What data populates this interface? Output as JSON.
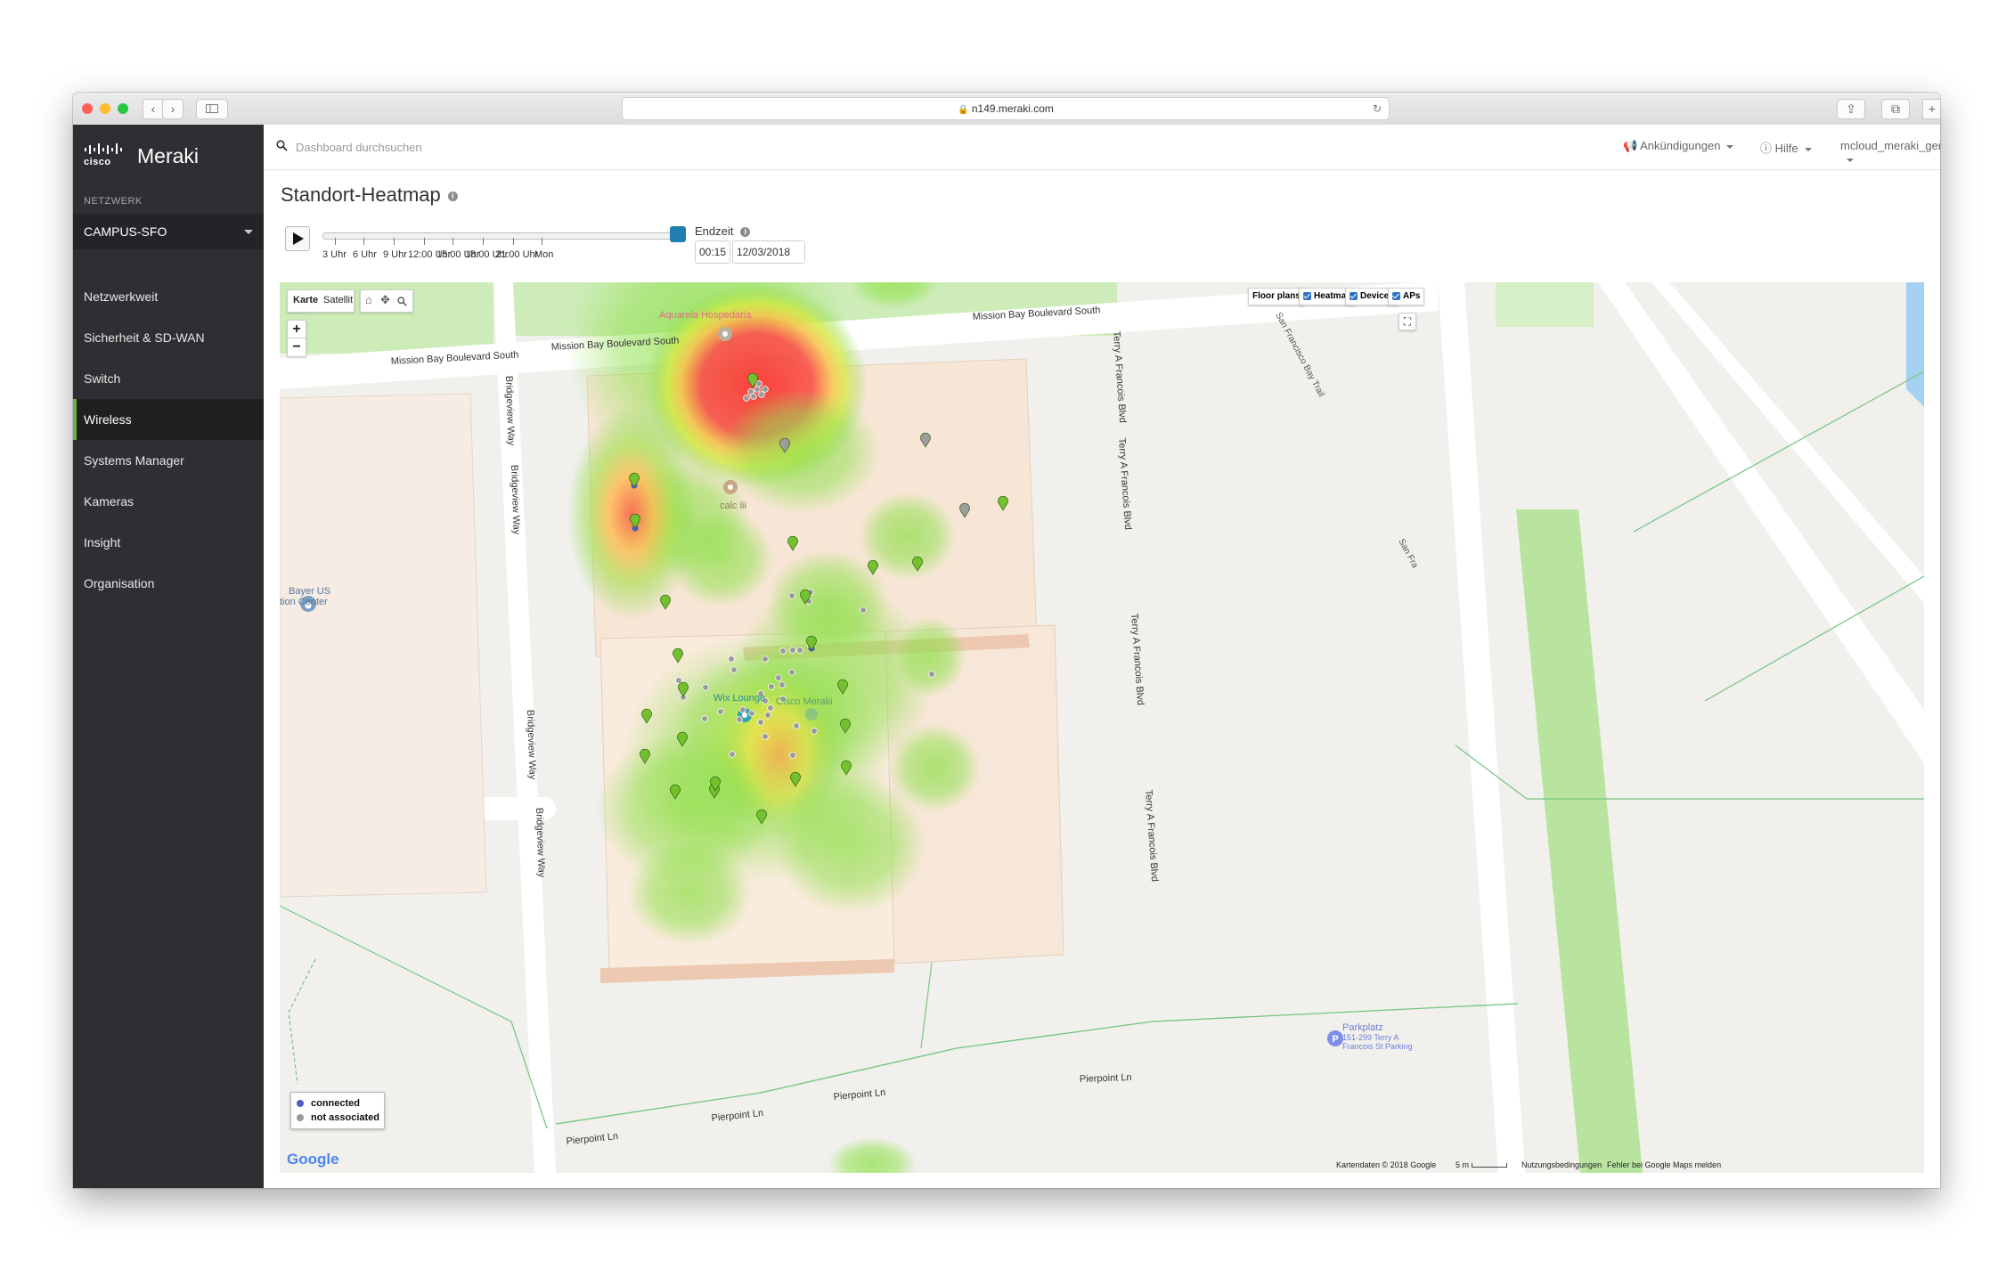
{
  "browser": {
    "url": "n149.meraki.com"
  },
  "sidebar": {
    "logo_cisco": "cisco",
    "logo_meraki": "Meraki",
    "network_label": "NETZWERK",
    "network_value": "CAMPUS-SFO",
    "items": [
      {
        "label": "Netzwerkweit"
      },
      {
        "label": "Sicherheit & SD-WAN"
      },
      {
        "label": "Switch"
      },
      {
        "label": "Wireless",
        "active": true
      },
      {
        "label": "Systems Manager"
      },
      {
        "label": "Kameras"
      },
      {
        "label": "Insight"
      },
      {
        "label": "Organisation"
      }
    ]
  },
  "topbar": {
    "search_placeholder": "Dashboard durchsuchen",
    "announcements": "Ankündigungen",
    "help": "Hilfe",
    "user": "mcloud_meraki_german"
  },
  "page": {
    "title": "Standort-Heatmap"
  },
  "timeline": {
    "tick_labels": [
      "3 Uhr",
      "6 Uhr",
      "9 Uhr",
      "12:00 Uhr",
      "15:00 Uhr",
      "18:00 Uhr",
      "21:00 Uhr",
      "Mon"
    ],
    "end_label": "Endzeit",
    "end_time": "00:15",
    "end_date": "12/03/2018",
    "position": 1.0
  },
  "map": {
    "type_buttons": [
      "Karte",
      "Satellit"
    ],
    "zoom_in": "+",
    "zoom_out": "−",
    "layers": {
      "floor_plans": "Floor plans",
      "heatmap": "Heatmap",
      "devices": "Devices",
      "aps": "APs"
    },
    "street_labels": {
      "mission_bay_1": "Mission Bay Boulevard South",
      "mission_bay_2": "Mission Bay Boulevard South",
      "mission_bay_3": "Mission Bay Boulevard South",
      "bridgeview_1": "Bridgeview Way",
      "bridgeview_2": "Bridgeview Way",
      "bridgeview_3": "Bridgeview Way",
      "bridgeview_4": "Bridgeview Way",
      "terry_1": "Terry A Francois Blvd",
      "terry_2": "Terry A Francois Blvd",
      "terry_3": "Terry A Francois Blvd",
      "terry_4": "Terry A Francois Blvd",
      "pierpoint_1": "Pierpoint Ln",
      "pierpoint_2": "Pierpoint Ln",
      "pierpoint_3": "Pierpoint Ln",
      "pierpoint_4": "Pierpoint Ln",
      "bay_trail": "San Francisco Bay Trail",
      "bay_trail_2": "San Fra"
    },
    "poi": {
      "aquarela": "Aquarela Hospedaria",
      "calc": "calc iii",
      "bayer_1": "Bayer US",
      "bayer_2": "tion Center",
      "wix": "Wix Lounge",
      "cisco_meraki": "Cisco Meraki",
      "parkplatz": "Parkplatz",
      "parkplatz_sub_1": "151-299 Terry A",
      "parkplatz_sub_2": "Francois St Parking"
    },
    "legend": {
      "connected": "connected",
      "not_associated": "not associated"
    },
    "google": "Google",
    "attribution": {
      "data": "Kartendaten © 2018 Google",
      "scale": "5 m",
      "terms": "Nutzungsbedingungen",
      "report": "Fehler bei Google Maps melden"
    },
    "colors": {
      "connected": "#4a5fc4",
      "not_associated": "#9a9a9a",
      "ap_marker": "#74c12e",
      "heat_low": "#7dd84a",
      "heat_high": "#ff3535"
    }
  }
}
